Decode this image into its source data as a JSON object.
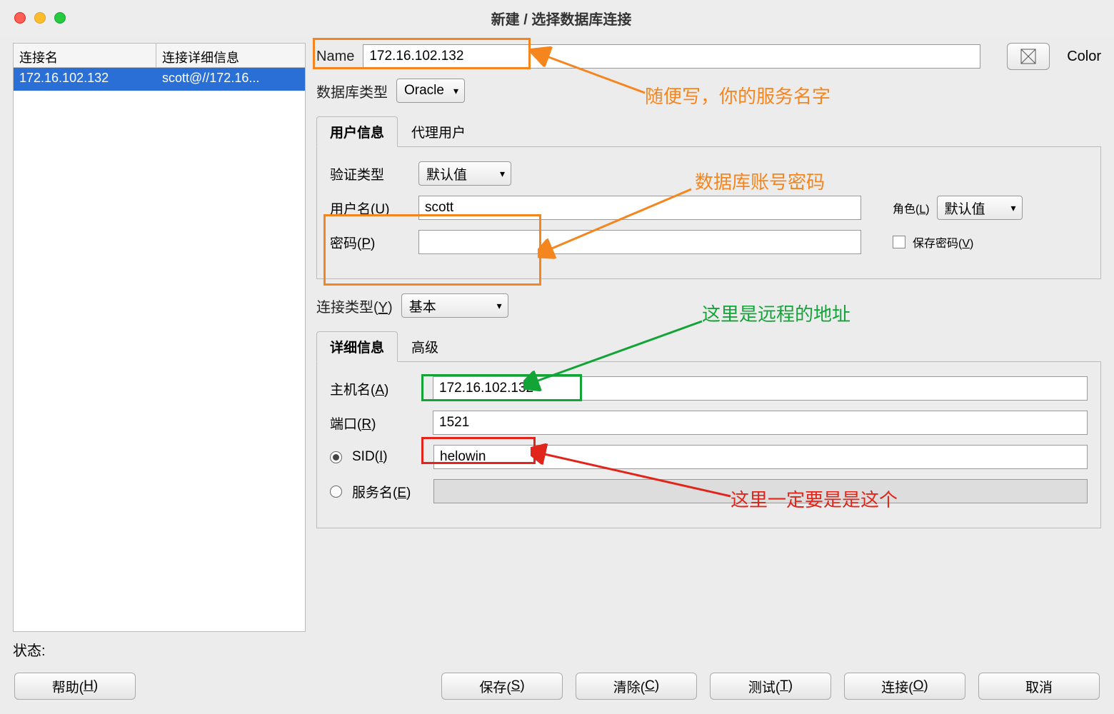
{
  "window": {
    "title": "新建 / 选择数据库连接"
  },
  "connections": {
    "headers": [
      "连接名",
      "连接详细信息"
    ],
    "row": {
      "name": "172.16.102.132",
      "detail": "scott@//172.16..."
    }
  },
  "status_label": "状态:",
  "form": {
    "name_label": "Name",
    "name_value": "172.16.102.132",
    "db_type_label": "数据库类型",
    "db_type_value": "Oracle",
    "color_label": "Color"
  },
  "tabs_user": {
    "user_info": "用户信息",
    "proxy_user": "代理用户"
  },
  "auth": {
    "type_label": "验证类型",
    "type_value": "默认值",
    "username_label": "用户名(U)",
    "username_value": "scott",
    "password_label": "密码(P)",
    "password_value": "",
    "role_label": "角色(L)",
    "role_value": "默认值",
    "save_pwd_label": "保存密码(V)"
  },
  "conn": {
    "type_label": "连接类型(Y)",
    "type_value": "基本"
  },
  "tabs_detail": {
    "detail": "详细信息",
    "advanced": "高级"
  },
  "detail": {
    "host_label": "主机名(A)",
    "host_value": "172.16.102.132",
    "port_label": "端口(R)",
    "port_value": "1521",
    "sid_label": "SID(I)",
    "sid_value": "helowin",
    "service_label": "服务名(E)",
    "service_value": ""
  },
  "buttons": {
    "help": "帮助(H)",
    "save": "保存(S)",
    "clear": "清除(C)",
    "test": "测试(T)",
    "connect": "连接(O)",
    "cancel": "取消"
  },
  "annotations": {
    "name_note": "随便写，你的服务名字",
    "cred_note": "数据库账号密码",
    "host_note": "这里是远程的地址",
    "sid_note": "这里一定要是是这个"
  }
}
